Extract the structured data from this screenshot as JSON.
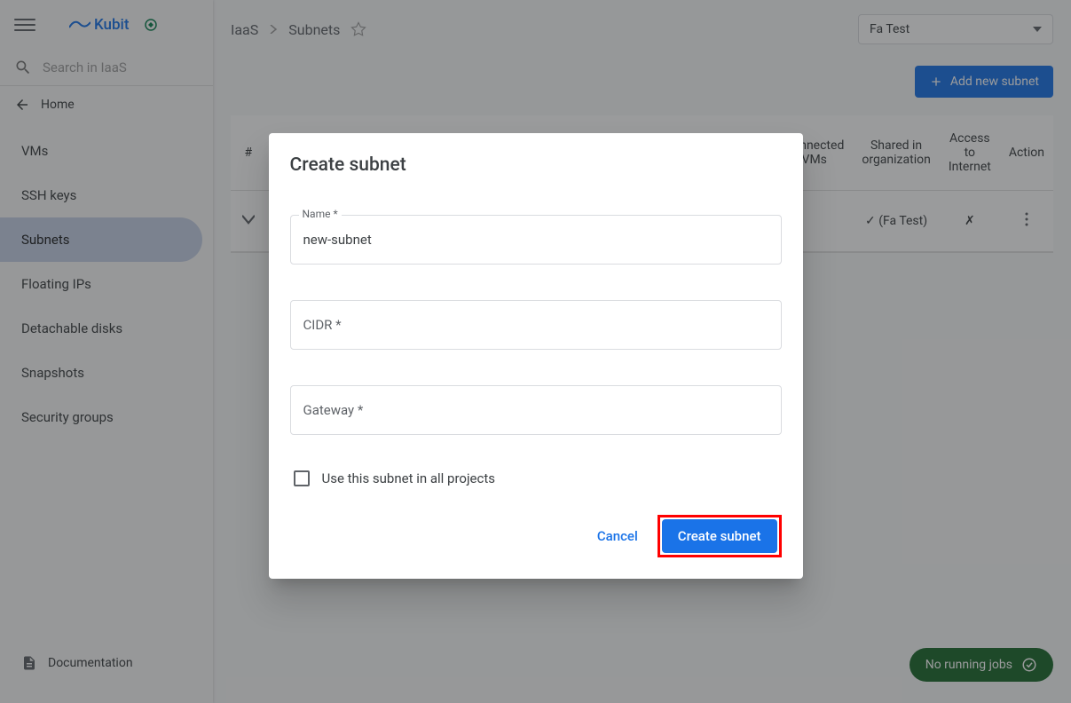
{
  "header": {
    "brand": "Kubit"
  },
  "search": {
    "placeholder": "Search in IaaS"
  },
  "sidebar": {
    "home": "Home",
    "items": [
      {
        "label": "VMs"
      },
      {
        "label": "SSH keys"
      },
      {
        "label": "Subnets"
      },
      {
        "label": "Floating IPs"
      },
      {
        "label": "Detachable disks"
      },
      {
        "label": "Snapshots"
      },
      {
        "label": "Security groups"
      }
    ],
    "documentation": "Documentation"
  },
  "breadcrumb": {
    "root": "IaaS",
    "current": "Subnets"
  },
  "project_select": {
    "value": "Fa Test"
  },
  "toolbar": {
    "add_subnet_label": "Add new subnet"
  },
  "table": {
    "headers": {
      "index": "#",
      "connected": "Connected VMs",
      "shared": "Shared in organization",
      "internet": "Access to Internet",
      "action": "Action"
    },
    "row": {
      "shared": "✓ (Fa Test)",
      "internet": "✗"
    }
  },
  "modal": {
    "title": "Create subnet",
    "name_label": "Name *",
    "name_value": "new-subnet",
    "cidr_placeholder": "CIDR *",
    "gateway_placeholder": "Gateway *",
    "checkbox_label": "Use this subnet in all projects",
    "cancel": "Cancel",
    "create": "Create subnet"
  },
  "jobs": {
    "label": "No running jobs"
  }
}
